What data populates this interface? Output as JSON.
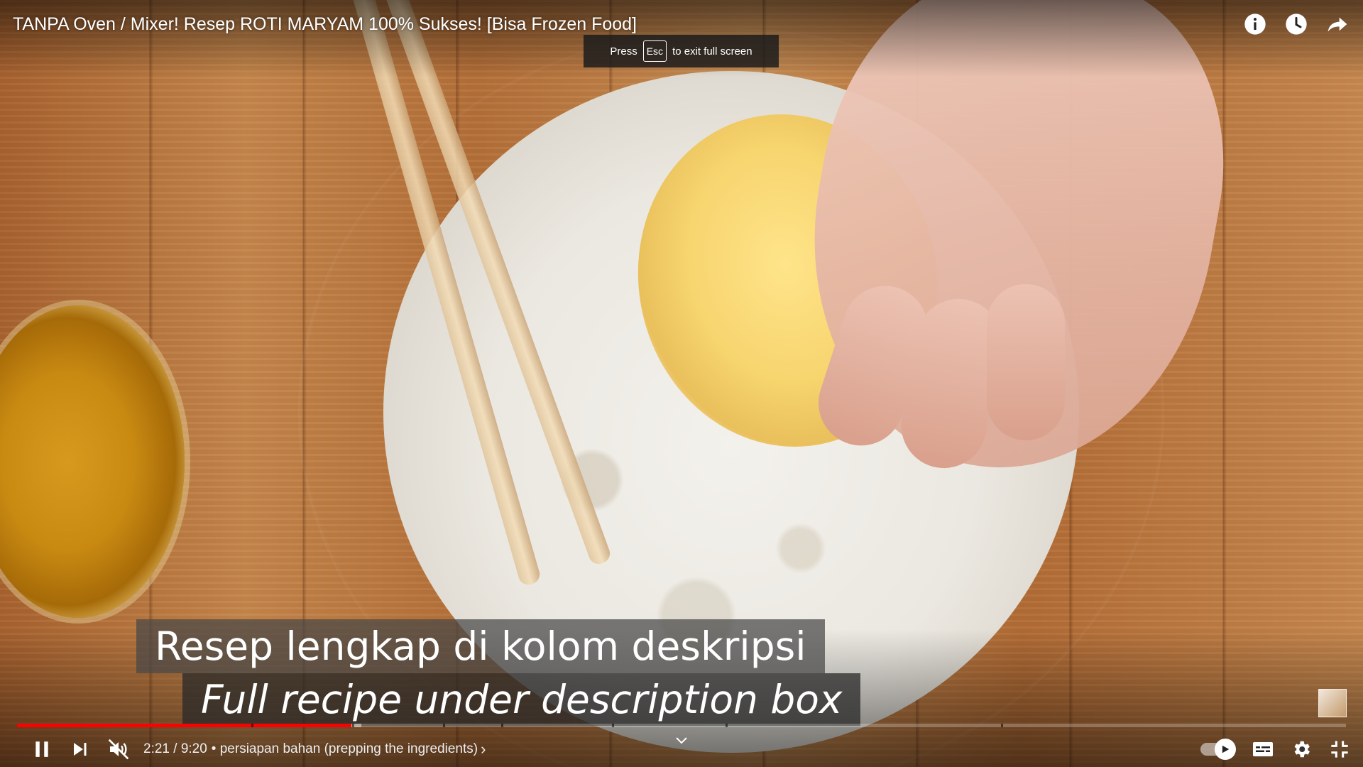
{
  "video": {
    "title": "TANPA Oven / Mixer! Resep ROTI MARYAM 100% Sukses! [Bisa Frozen Food]"
  },
  "fullscreen_toast": {
    "press": "Press",
    "key": "Esc",
    "suffix": "to exit full screen"
  },
  "captions": {
    "line1": "Resep lengkap di kolom deskripsi",
    "line2": "Full recipe under description box"
  },
  "playback": {
    "current_time": "2:21",
    "separator": "/",
    "duration": "9:20",
    "time_display": "2:21 / 9:20",
    "chapter_prefix": "•",
    "chapter_title": "persiapan bahan (prepping the ingredients)",
    "chapter_display": "• persiapan bahan (prepping the ingredients)",
    "chapter_arrow": "›",
    "played_fraction": 0.2518,
    "buffered_fraction": 0.2589,
    "muted": true,
    "playing": true,
    "autoplay": true
  },
  "icons": {
    "top": [
      "info-icon",
      "watch-later-icon",
      "share-icon"
    ],
    "controls_left": [
      "pause-icon",
      "next-icon",
      "volume-muted-icon"
    ],
    "controls_right": [
      "autoplay-toggle-icon",
      "captions-icon",
      "settings-icon",
      "exit-fullscreen-icon"
    ]
  },
  "colors": {
    "progress_played": "#ff0000",
    "progress_buffer": "#bdbdbd",
    "text": "#ffffff"
  }
}
